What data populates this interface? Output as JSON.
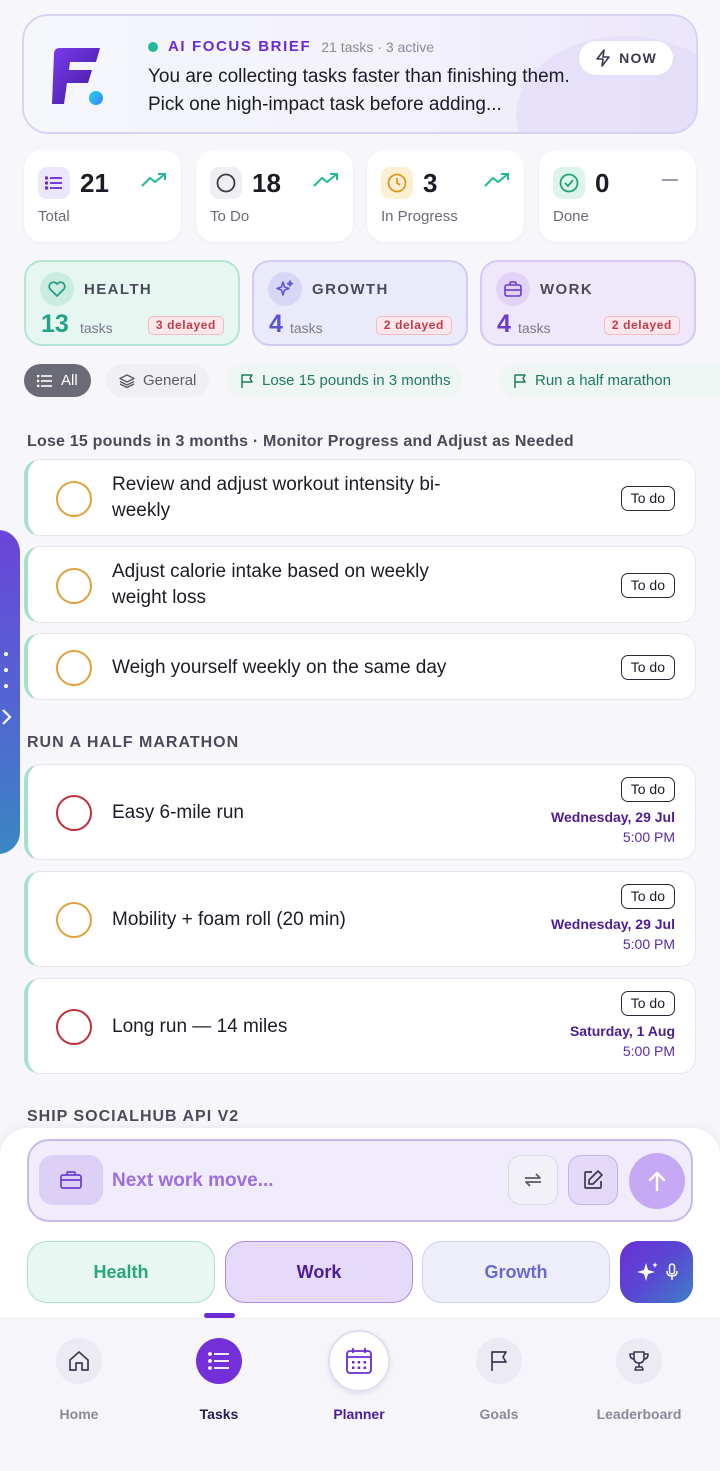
{
  "brief": {
    "label": "AI FOCUS BRIEF",
    "meta": "21 tasks · 3 active",
    "text": "You are collecting tasks faster than finishing them. Pick one high-impact task before adding...",
    "now_label": "NOW",
    "logo_letter": "F"
  },
  "stats": [
    {
      "value": "21",
      "label": "Total",
      "icon": "list-icon",
      "trend": "trending-up-icon"
    },
    {
      "value": "18",
      "label": "To Do",
      "icon": "circle-icon",
      "trend": "trending-up-icon"
    },
    {
      "value": "3",
      "label": "In Progress",
      "icon": "clock-icon",
      "trend": "trending-up-icon"
    },
    {
      "value": "0",
      "label": "Done",
      "icon": "check-circle-icon",
      "trend": "flat-dash-icon"
    }
  ],
  "categories": [
    {
      "name": "HEALTH",
      "count": "13",
      "unit": "tasks",
      "delayed": "3 delayed",
      "icon": "heart-icon",
      "color": "#22a389"
    },
    {
      "name": "GROWTH",
      "count": "4",
      "unit": "tasks",
      "delayed": "2 delayed",
      "icon": "sparkles-icon",
      "color": "#5a55d6"
    },
    {
      "name": "WORK",
      "count": "4",
      "unit": "tasks",
      "delayed": "2 delayed",
      "icon": "briefcase-icon",
      "color": "#6a3dd1"
    }
  ],
  "filters": {
    "all": "All",
    "general": "General",
    "goal1": "Lose 15 pounds in 3 months",
    "goal2": "Run a half marathon"
  },
  "sections": {
    "s1": "Lose 15 pounds in 3 months · Monitor Progress and Adjust as Needed",
    "s2": "RUN A HALF MARATHON",
    "s3": "SHIP SOCIALHUB API V2"
  },
  "tasks": [
    {
      "line1": "Review and adjust workout intensity bi-",
      "line2": "weekly",
      "status": "To do"
    },
    {
      "line1": "Adjust calorie intake based on weekly",
      "line2": "weight loss",
      "status": "To do"
    },
    {
      "title": "Weigh yourself weekly on the same day",
      "status": "To do"
    },
    {
      "title": "Easy 6-mile run",
      "status": "To do",
      "date": "Wednesday, 29 Jul",
      "time": "5:00 PM"
    },
    {
      "title": "Mobility + foam roll (20 min)",
      "status": "To do",
      "date": "Wednesday, 29 Jul",
      "time": "5:00 PM"
    },
    {
      "title": "Long run — 14 miles",
      "status": "To do",
      "date": "Saturday, 1 Aug",
      "time": "5:00 PM"
    }
  ],
  "composer": {
    "placeholder": "Next work move..."
  },
  "quick": {
    "health": "Health",
    "work": "Work",
    "growth": "Growth"
  },
  "nav": {
    "home": "Home",
    "tasks": "Tasks",
    "planner": "Planner",
    "goals": "Goals",
    "leaderboard": "Leaderboard"
  },
  "colors": {
    "accent": "#6a2bd3",
    "teal": "#22b89a",
    "delay_red": "#c23b4c",
    "todo_orange": "#e1a13a",
    "overdue_red": "#c22f3a"
  }
}
